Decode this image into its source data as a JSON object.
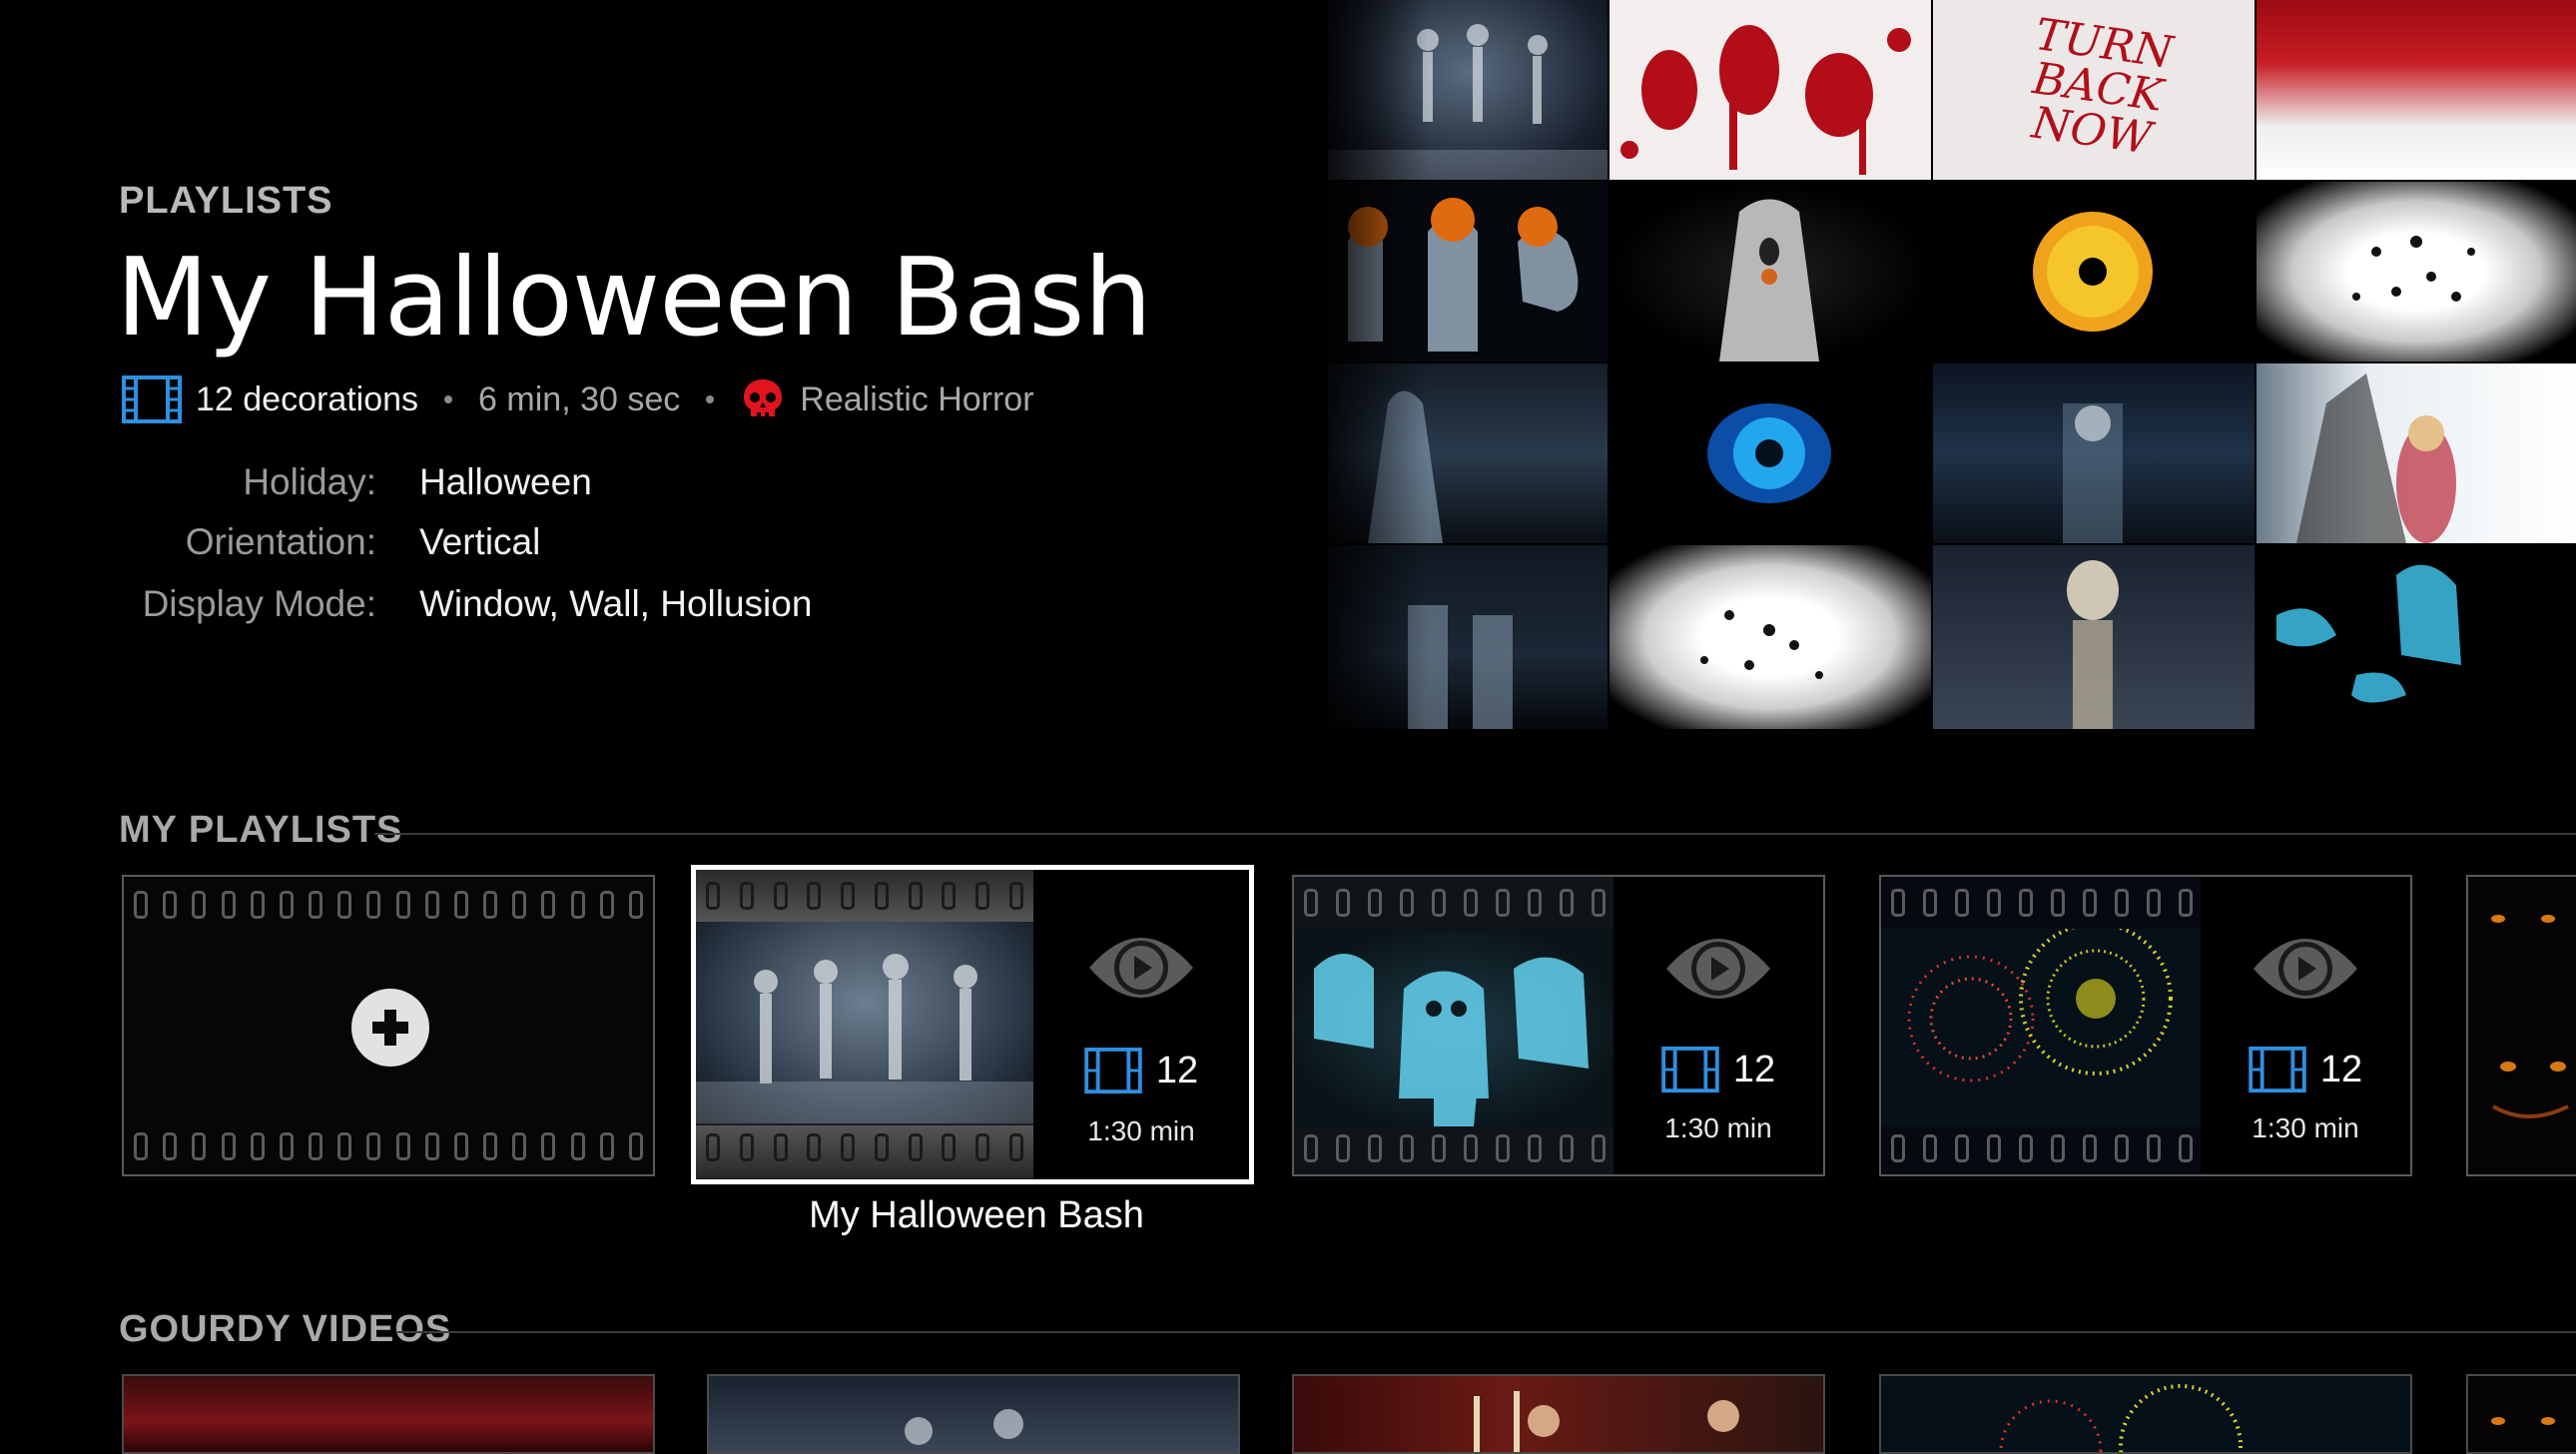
{
  "header": {
    "section": "PLAYLISTS",
    "title": "My Halloween Bash",
    "decorations": "12 decorations",
    "duration": "6 min, 30 sec",
    "genre": "Realistic Horror"
  },
  "properties": [
    {
      "label": "Holiday:",
      "value": "Halloween"
    },
    {
      "label": "Orientation:",
      "value": "Vertical"
    },
    {
      "label": "Display Mode:",
      "value": "Window, Wall, Hollusion"
    }
  ],
  "mosaic_text": "TURN BACK NOW",
  "sections": {
    "my_playlists": "MY PLAYLISTS",
    "gourdy_videos": "GOURDY VIDEOS"
  },
  "playlists": [
    {
      "count": "12",
      "duration": "1:30 min",
      "caption": "My Halloween Bash"
    },
    {
      "count": "12",
      "duration": "1:30 min"
    },
    {
      "count": "12",
      "duration": "1:30 min"
    }
  ],
  "colors": {
    "accent_blue": "#2f8fe0",
    "skull_red": "#e0141c",
    "background": "#000000"
  },
  "icons": [
    "film-icon",
    "skull-icon",
    "add-icon",
    "eye-play-icon"
  ]
}
